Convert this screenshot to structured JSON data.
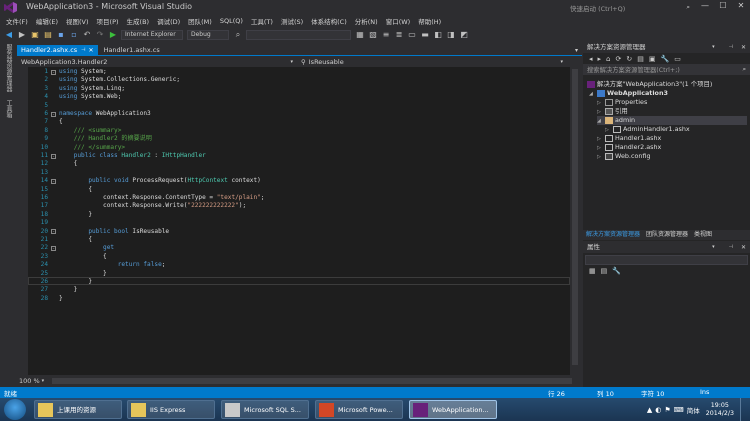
{
  "window": {
    "title": "WebApplication3 - Microsoft Visual Studio",
    "quick_launch_placeholder": "快速启动 (Ctrl+Q)",
    "minimize": "—",
    "maximize": "☐",
    "close": "✕"
  },
  "menu": [
    "文件(F)",
    "编辑(E)",
    "视图(V)",
    "项目(P)",
    "生成(B)",
    "调试(D)",
    "团队(M)",
    "SQL(Q)",
    "工具(T)",
    "测试(S)",
    "体系结构(C)",
    "分析(N)",
    "窗口(W)",
    "帮助(H)"
  ],
  "toolbar": {
    "run_target": "Internet Explorer",
    "configuration": "Debug"
  },
  "left_strip": {
    "server_explorer": "服务器资源管理器",
    "toolbox": "工具箱"
  },
  "tabs": [
    {
      "label": "Handler2.ashx.cs",
      "active": true
    },
    {
      "label": "Handler1.ashx.cs",
      "active": false
    }
  ],
  "nav": {
    "type": "WebApplication3.Handler2",
    "member": "IsReusable"
  },
  "code": [
    {
      "n": "1",
      "t": "using System;"
    },
    {
      "n": "2",
      "t": "using System.Collections.Generic;"
    },
    {
      "n": "3",
      "t": "using System.Linq;"
    },
    {
      "n": "4",
      "t": "using System.Web;"
    },
    {
      "n": "5",
      "t": ""
    },
    {
      "n": "6",
      "t": "namespace WebApplication3"
    },
    {
      "n": "7",
      "t": "{"
    },
    {
      "n": "8",
      "t": "    /// <summary>"
    },
    {
      "n": "9",
      "t": "    /// Handler2 的摘要说明"
    },
    {
      "n": "10",
      "t": "    /// </summary>"
    },
    {
      "n": "11",
      "t": "    public class Handler2 : IHttpHandler"
    },
    {
      "n": "12",
      "t": "    {"
    },
    {
      "n": "13",
      "t": ""
    },
    {
      "n": "14",
      "t": "        public void ProcessRequest(HttpContext context)"
    },
    {
      "n": "15",
      "t": "        {"
    },
    {
      "n": "16",
      "t": "            context.Response.ContentType = \"text/plain\";"
    },
    {
      "n": "17",
      "t": "            context.Response.Write(\"222222222222\");"
    },
    {
      "n": "18",
      "t": "        }"
    },
    {
      "n": "19",
      "t": ""
    },
    {
      "n": "20",
      "t": "        public bool IsReusable"
    },
    {
      "n": "21",
      "t": "        {"
    },
    {
      "n": "22",
      "t": "            get"
    },
    {
      "n": "23",
      "t": "            {"
    },
    {
      "n": "24",
      "t": "                return false;"
    },
    {
      "n": "25",
      "t": "            }"
    },
    {
      "n": "26",
      "t": "        }"
    },
    {
      "n": "27",
      "t": "    }"
    },
    {
      "n": "28",
      "t": "}"
    }
  ],
  "zoom": "100 %",
  "solution_explorer": {
    "title": "解决方案资源管理器",
    "search_placeholder": "搜索解决方案资源管理器(Ctrl+;)",
    "items": [
      {
        "label": "解决方案\"WebApplication3\"(1 个项目)"
      },
      {
        "label": "WebApplication3"
      },
      {
        "label": "Properties"
      },
      {
        "label": "引用"
      },
      {
        "label": "admin"
      },
      {
        "label": "AdminHandler1.ashx"
      },
      {
        "label": "Handler1.ashx"
      },
      {
        "label": "Handler2.ashx"
      },
      {
        "label": "Web.config"
      }
    ],
    "bottom_tabs": [
      "解决方案资源管理器",
      "团队资源管理器",
      "类视图"
    ]
  },
  "properties": {
    "title": "属性"
  },
  "status": {
    "left": "就绪",
    "row": "行 26",
    "col": "列 10",
    "char": "字符 10",
    "mode": "Ins"
  },
  "taskbar": {
    "buttons": [
      "上课用的资源",
      "IIS Express",
      "Microsoft SQL S...",
      "Microsoft Powe...",
      "WebApplication..."
    ],
    "ime": "简体",
    "time": "19:05",
    "date": "2014/2/3"
  },
  "colors": {
    "accent": "#007acc",
    "background": "#2d2d30",
    "editor": "#1e1e1e"
  }
}
